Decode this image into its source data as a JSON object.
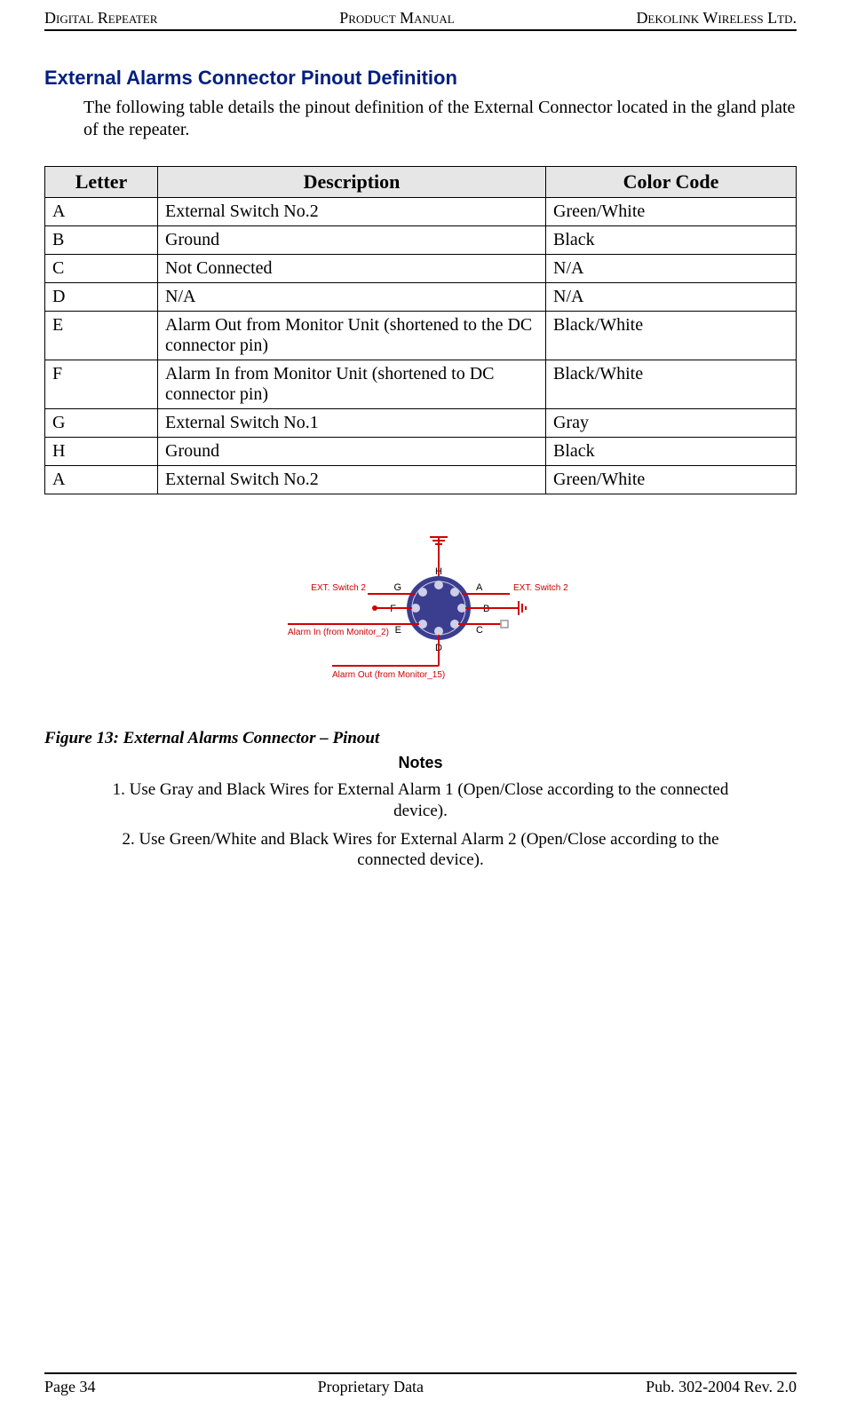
{
  "header": {
    "left": "Digital Repeater",
    "center": "Product Manual",
    "right": "Dekolink Wireless Ltd."
  },
  "section_title": "External Alarms Connector Pinout Definition",
  "intro": "The following table details the pinout definition of the External Connector located in the gland plate of the repeater.",
  "table": {
    "headers": {
      "letter": "Letter",
      "description": "Description",
      "color": "Color Code"
    },
    "rows": [
      {
        "letter": "A",
        "description": "External Switch No.2",
        "color": "Green/White"
      },
      {
        "letter": "B",
        "description": "Ground",
        "color": "Black"
      },
      {
        "letter": "C",
        "description": "Not Connected",
        "color": "N/A"
      },
      {
        "letter": "D",
        "description": "N/A",
        "color": "N/A"
      },
      {
        "letter": "E",
        "description": "Alarm Out from Monitor Unit (shortened to the DC connector pin)",
        "color": "Black/White"
      },
      {
        "letter": "F",
        "description": "Alarm In from Monitor Unit (shortened to DC connector pin)",
        "color": "Black/White"
      },
      {
        "letter": "G",
        "description": "External Switch No.1",
        "color": "Gray"
      },
      {
        "letter": "H",
        "description": "Ground",
        "color": "Black"
      },
      {
        "letter": "A",
        "description": "External Switch No.2",
        "color": "Green/White"
      }
    ]
  },
  "diagram": {
    "labels": {
      "ext_switch_left": "EXT. Switch 2",
      "ext_switch_right": "EXT. Switch 2",
      "alarm_in": "Alarm In (from Monitor_2)",
      "alarm_out": "Alarm Out (from Monitor_15)",
      "pins": {
        "A": "A",
        "B": "B",
        "C": "C",
        "D": "D",
        "E": "E",
        "F": "F",
        "G": "G",
        "H": "H"
      }
    }
  },
  "figure_caption": "Figure 13: External Alarms Connector – Pinout",
  "notes_heading": "Notes",
  "notes": [
    "1. Use Gray and Black Wires for External Alarm 1  (Open/Close according to the connected device).",
    "2. Use Green/White and Black Wires for External Alarm 2 (Open/Close according to the connected device)."
  ],
  "footer": {
    "left": "Page 34",
    "center": "Proprietary Data",
    "right": "Pub. 302-2004 Rev. 2.0"
  }
}
